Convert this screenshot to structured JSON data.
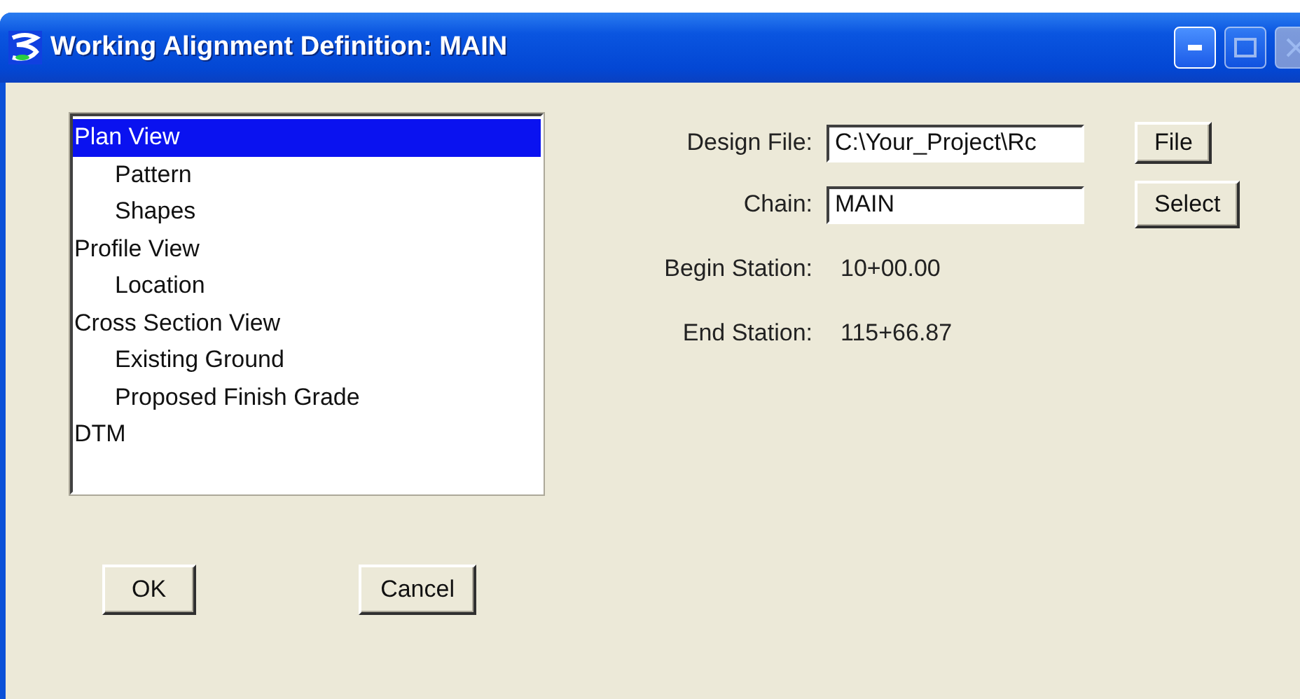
{
  "window": {
    "title": "Working Alignment Definition: MAIN"
  },
  "tree": [
    {
      "label": "Plan View",
      "selected": true,
      "children": [
        {
          "label": "Pattern",
          "selected": false
        },
        {
          "label": "Shapes",
          "selected": false
        }
      ]
    },
    {
      "label": "Profile View",
      "selected": false,
      "children": [
        {
          "label": "Location",
          "selected": false
        }
      ]
    },
    {
      "label": "Cross Section View",
      "selected": false,
      "children": [
        {
          "label": "Existing Ground",
          "selected": false
        },
        {
          "label": "Proposed Finish Grade",
          "selected": false
        }
      ]
    },
    {
      "label": "DTM",
      "selected": false
    }
  ],
  "fields": [
    {
      "kind": "input",
      "label": "Design File:",
      "value": "C:\\Your_Project\\Rc",
      "button": "File"
    },
    {
      "kind": "input",
      "label": "Chain:",
      "value": "MAIN",
      "button": "Select"
    },
    {
      "kind": "text",
      "label": "Begin Station:",
      "value": "10+00.00"
    },
    {
      "kind": "text",
      "label": "End Station:",
      "value": "115+66.87"
    }
  ],
  "buttons": [
    "OK",
    "Cancel"
  ]
}
